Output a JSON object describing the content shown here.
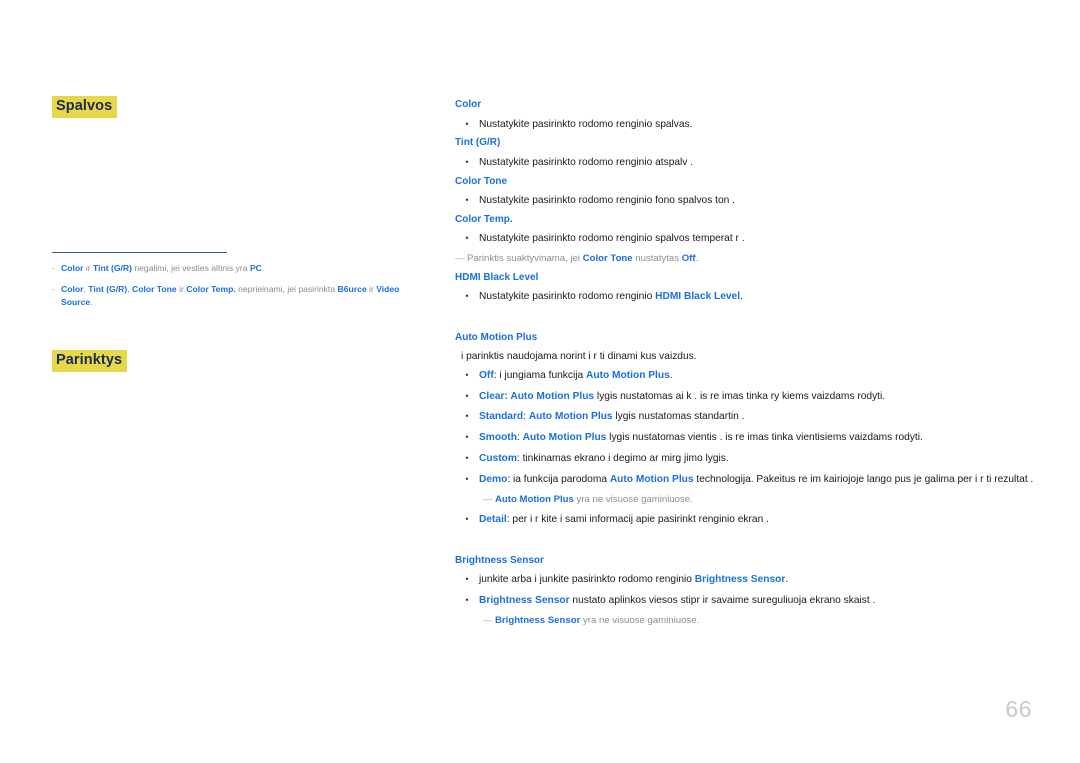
{
  "page": {
    "number": "66",
    "background": "#ffffff",
    "accent_blue": "#1c6fe0",
    "highlight_yellow": "#e6d84a",
    "note_gray": "#8b8b8b"
  },
  "left_column": {
    "headings": [
      {
        "id": "colors",
        "label": "Spalvos"
      },
      {
        "id": "options",
        "label": "Parinktys"
      }
    ],
    "notes": [
      {
        "dash": "-",
        "parts": [
          {
            "text": "Color",
            "style": "blue-b"
          },
          {
            "text": " ir ",
            "style": "gray"
          },
          {
            "text": "Tint (G/R)",
            "style": "blue-b"
          },
          {
            "text": " negalimi, jei  vesties  altinis yra ",
            "style": "gray"
          },
          {
            "text": "PC",
            "style": "blue-b"
          },
          {
            "text": ".",
            "style": "gray"
          }
        ]
      },
      {
        "dash": "-",
        "parts": [
          {
            "text": "Color",
            "style": "blue-b"
          },
          {
            "text": ", ",
            "style": "gray"
          },
          {
            "text": "Tint (G/R)",
            "style": "blue-b"
          },
          {
            "text": ", ",
            "style": "gray"
          },
          {
            "text": "Color Tone",
            "style": "blue-b"
          },
          {
            "text": " ir ",
            "style": "gray"
          },
          {
            "text": "Color Temp.",
            "style": "blue-b"
          },
          {
            "text": " neprieinami, jei pasirinkta ",
            "style": "gray"
          },
          {
            "text": "B6urce",
            "style": "blue-b"
          },
          {
            "text": " ir ",
            "style": "gray"
          },
          {
            "text": "Video Source",
            "style": "blue-b"
          },
          {
            "text": ".",
            "style": "gray"
          }
        ]
      }
    ]
  },
  "right_column": {
    "blocks": [
      {
        "type": "heading",
        "label": "Color"
      },
      {
        "type": "bullet",
        "parts": [
          {
            "text": "Nustatykite pasirinkto rodomo  renginio spalvas.",
            "style": "plain"
          }
        ]
      },
      {
        "type": "heading",
        "label": "Tint (G/R)"
      },
      {
        "type": "bullet",
        "parts": [
          {
            "text": "Nustatykite pasirinkto rodomo  renginio atspalv .",
            "style": "plain"
          }
        ]
      },
      {
        "type": "heading",
        "label": "Color Tone"
      },
      {
        "type": "bullet",
        "parts": [
          {
            "text": "Nustatykite pasirinkto rodomo  renginio fono spalvos ton .",
            "style": "plain"
          }
        ]
      },
      {
        "type": "heading",
        "label": "Color Temp."
      },
      {
        "type": "bullet",
        "parts": [
          {
            "text": "Nustatykite pasirinkto rodomo  renginio spalvos temperat r .",
            "style": "plain"
          }
        ]
      },
      {
        "type": "subnote",
        "parts": [
          {
            "text": "Parinktis suaktyvinama, jei ",
            "style": "gray"
          },
          {
            "text": "Color Tone",
            "style": "blue-b"
          },
          {
            "text": " nustatytas   ",
            "style": "gray"
          },
          {
            "text": "Off",
            "style": "blue-b"
          },
          {
            "text": ".",
            "style": "gray"
          }
        ]
      },
      {
        "type": "heading",
        "label": "HDMI Black Level"
      },
      {
        "type": "bullet",
        "parts": [
          {
            "text": "Nustatykite pasirinkto rodomo  renginio ",
            "style": "plain"
          },
          {
            "text": "HDMI Black Level",
            "style": "blue-b"
          },
          {
            "text": ".",
            "style": "plain"
          }
        ]
      },
      {
        "type": "gap"
      },
      {
        "type": "heading",
        "label": "Auto Motion Plus"
      },
      {
        "type": "plain",
        "parts": [
          {
            "text": "i parinktis naudojama norint  i r ti dinami kus vaizdus.",
            "style": "plain"
          }
        ]
      },
      {
        "type": "bullet",
        "parts": [
          {
            "text": "Off",
            "style": "blue-b"
          },
          {
            "text": ": i jungiama funkcija ",
            "style": "plain"
          },
          {
            "text": "Auto Motion Plus",
            "style": "blue-b"
          },
          {
            "text": ".",
            "style": "plain"
          }
        ]
      },
      {
        "type": "bullet",
        "parts": [
          {
            "text": "Clear",
            "style": "blue-b"
          },
          {
            "text": ": ",
            "style": "blue-b"
          },
          {
            "text": "Auto Motion Plus",
            "style": "blue-b"
          },
          {
            "text": " lygis nustatomas   ai k .  is re imas tinka ry kiems vaizdams rodyti.",
            "style": "plain"
          }
        ]
      },
      {
        "type": "bullet",
        "parts": [
          {
            "text": "Standard",
            "style": "blue-b"
          },
          {
            "text": ": ",
            "style": "plain"
          },
          {
            "text": "Auto Motion Plus",
            "style": "blue-b"
          },
          {
            "text": " lygis nustatomas   standartin .",
            "style": "plain"
          }
        ]
      },
      {
        "type": "bullet",
        "parts": [
          {
            "text": "Smooth",
            "style": "blue-b"
          },
          {
            "text": ": ",
            "style": "plain"
          },
          {
            "text": "Auto Motion Plus",
            "style": "blue-b"
          },
          {
            "text": " lygis nustatomas   vientis .  is re imas tinka vientisiems vaizdams rodyti.",
            "style": "plain"
          }
        ]
      },
      {
        "type": "bullet",
        "parts": [
          {
            "text": "Custom",
            "style": "blue-b"
          },
          {
            "text": ": tinkinamas ekrano i degimo ar mirg jimo lygis.",
            "style": "plain"
          }
        ]
      },
      {
        "type": "bullet",
        "parts": [
          {
            "text": "Demo",
            "style": "blue-b"
          },
          {
            "text": ":  ia funkcija parodoma ",
            "style": "plain"
          },
          {
            "text": "Auto Motion Plus",
            "style": "blue-b"
          },
          {
            "text": " technologija. Pakeitus re im  kairiojoje lango pus je galima per i r ti rezultat .",
            "style": "plain"
          }
        ]
      },
      {
        "type": "subnote-indent",
        "parts": [
          {
            "text": "Auto Motion Plus",
            "style": "blue-b"
          },
          {
            "text": " yra ne visuose gaminiuose.",
            "style": "gray"
          }
        ]
      },
      {
        "type": "bullet",
        "parts": [
          {
            "text": "Detail",
            "style": "blue-b"
          },
          {
            "text": ": per i r kite i sami  informacij  apie pasirinkt   renginio ekran .",
            "style": "plain"
          }
        ]
      },
      {
        "type": "gap"
      },
      {
        "type": "heading",
        "label": "Brightness Sensor"
      },
      {
        "type": "bullet",
        "parts": [
          {
            "text": " junkite arba i junkite pasirinkto rodomo  renginio ",
            "style": "plain"
          },
          {
            "text": "Brightness Sensor",
            "style": "blue-b"
          },
          {
            "text": ".",
            "style": "plain"
          }
        ]
      },
      {
        "type": "bullet",
        "parts": [
          {
            "text": "Brightness Sensor",
            "style": "blue-b"
          },
          {
            "text": " nustato aplinkos  viesos stipr  ir savaime sureguliuoja ekrano skaist .",
            "style": "plain"
          }
        ]
      },
      {
        "type": "subnote-indent",
        "parts": [
          {
            "text": "Brightness Sensor",
            "style": "blue-b"
          },
          {
            "text": " yra ne visuose gaminiuose.",
            "style": "gray"
          }
        ]
      }
    ]
  }
}
